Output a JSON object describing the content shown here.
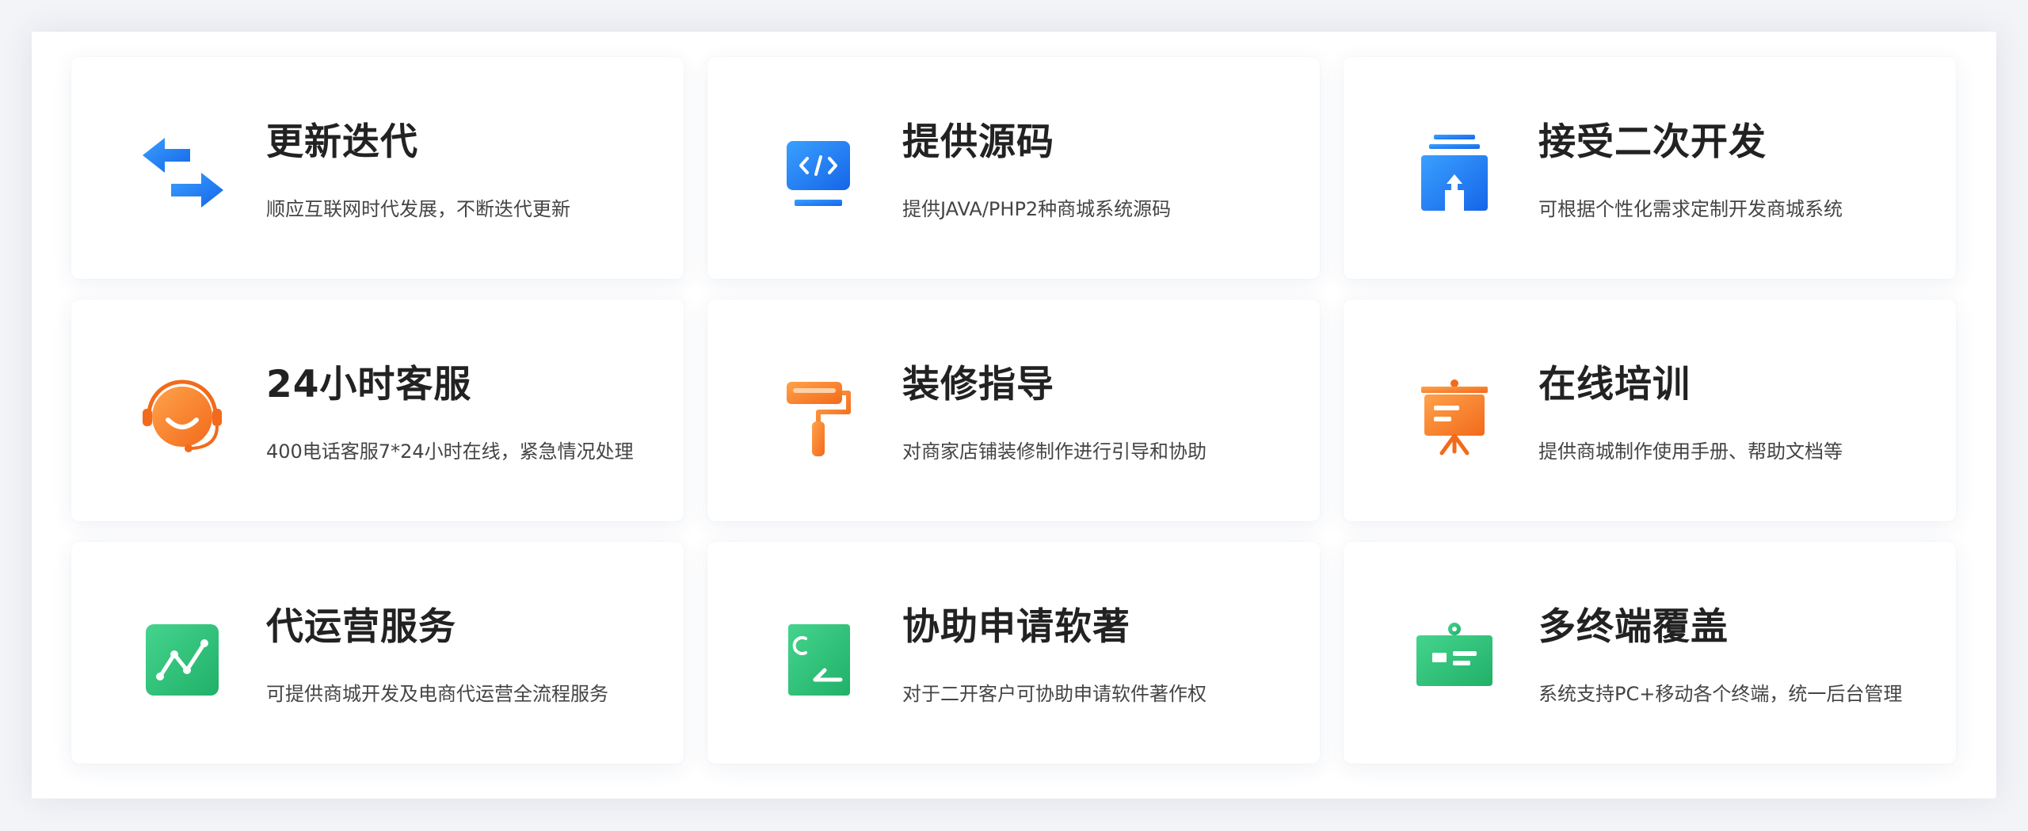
{
  "colors": {
    "blue": "#1e7cf2",
    "orange": "#f7802a",
    "green": "#2ec27a"
  },
  "features": [
    {
      "icon": "update-arrows-icon",
      "title": "更新迭代",
      "desc": "顺应互联网时代发展，不断迭代更新"
    },
    {
      "icon": "source-code-icon",
      "title": "提供源码",
      "desc": "提供JAVA/PHP2种商城系统源码"
    },
    {
      "icon": "secondary-development-icon",
      "title": "接受二次开发",
      "desc": "可根据个性化需求定制开发商城系统"
    },
    {
      "icon": "headset-support-icon",
      "title": "24小时客服",
      "desc": "400电话客服7*24小时在线，紧急情况处理"
    },
    {
      "icon": "paint-roller-icon",
      "title": "装修指导",
      "desc": "对商家店铺装修制作进行引导和协助"
    },
    {
      "icon": "presentation-board-icon",
      "title": "在线培训",
      "desc": "提供商城制作使用手册、帮助文档等"
    },
    {
      "icon": "line-chart-icon",
      "title": "代运营服务",
      "desc": "可提供商城开发及电商代运营全流程服务"
    },
    {
      "icon": "copyright-document-icon",
      "title": "协助申请软著",
      "desc": "对于二开客户可协助申请软件著作权"
    },
    {
      "icon": "multi-terminal-icon",
      "title": "多终端覆盖",
      "desc": "系统支持PC+移动各个终端，统一后台管理"
    }
  ]
}
